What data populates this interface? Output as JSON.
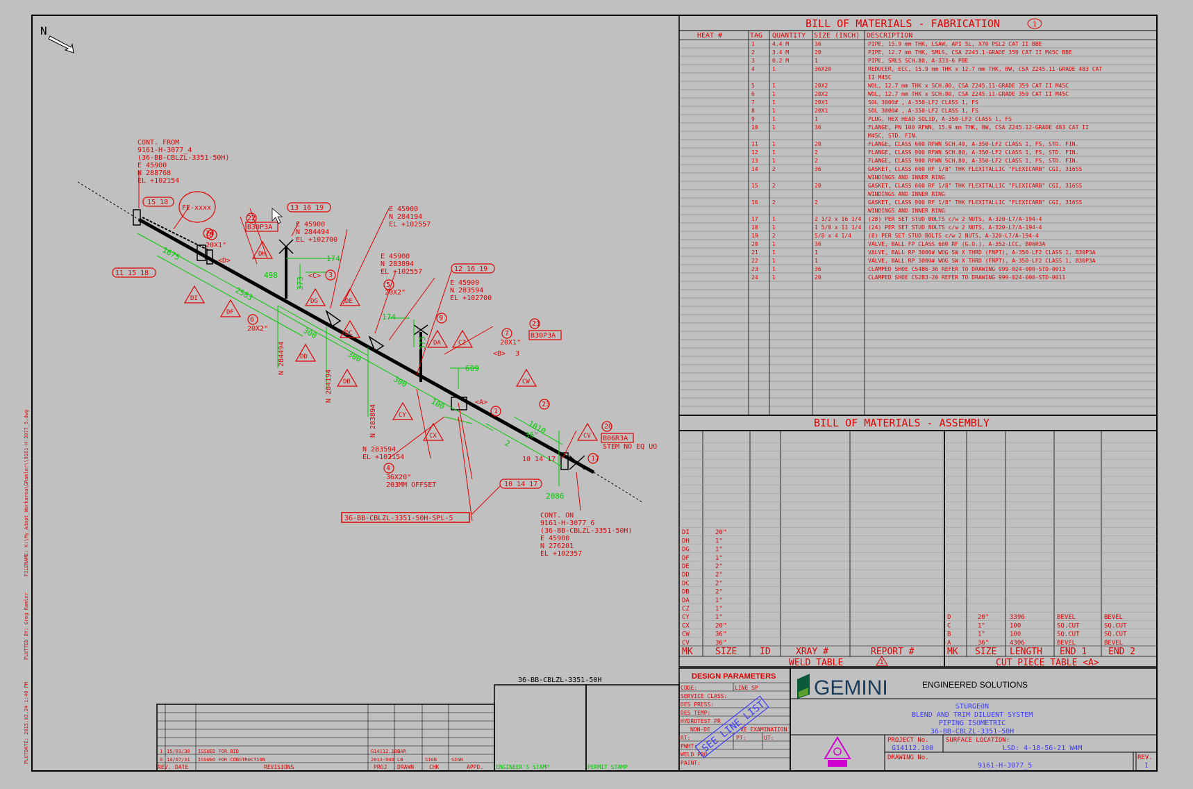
{
  "north": "N",
  "sheet_info": {
    "filename": "FILENAME: K:\\My_Adapt_Workarea\\GRamler\\\\9161-H-3077_5.dwg",
    "plotted_by": "PLOTTED BY: Greg Ramler",
    "plotdate": "PLOTDATE: 2015.03.24 1:40 PM"
  },
  "iso": {
    "cont_from": [
      "CONT. FROM",
      "9161-H-3077_4",
      "(36-BB-CBLZL-3351-50H)",
      "E 45900",
      "N 288768",
      "EL +102154"
    ],
    "cont_on": [
      "CONT. ON",
      "9161-H-3077_6",
      "(36-BB-CBLZL-3351-50H)",
      "E 45900",
      "N 276201",
      "EL +102357"
    ],
    "coord_a": [
      "E 45900",
      "N 284494",
      "EL +102700"
    ],
    "coord_b": [
      "E 45900",
      "N 284194",
      "EL +102557"
    ],
    "coord_c": [
      "E 45900",
      "N 283894",
      "EL +102557"
    ],
    "coord_d": [
      "E 45900",
      "N 283594",
      "EL +102700"
    ],
    "coord_e": [
      "N 283594",
      "EL +102154"
    ],
    "fe": "FE-xxxx",
    "bubbles": [
      "15 18",
      "13 16 19",
      "24",
      "22",
      "B30P3A",
      "8",
      "20X1\"",
      "<D>",
      "3",
      "<C>",
      "11 15 18",
      "498",
      "373",
      "174",
      "1675",
      "2583",
      "300",
      "6",
      "20X2\"",
      "5",
      "20X2\"",
      "12 16 19",
      "174",
      "9",
      "21",
      "B30P3A",
      "7",
      "20X1\"",
      "<B>",
      "3",
      "373",
      "609",
      "300",
      "300",
      "100",
      "<A>",
      "1",
      "23",
      "1010",
      "36\"",
      "20",
      "B06R3A",
      "STEM NO EQ UO",
      "4595",
      "2",
      "17",
      "10 14 17",
      "2086",
      "4",
      "36X20\"",
      "203MM OFFSET"
    ],
    "weld_tags": [
      "DI",
      "DF",
      "DH",
      "DG",
      "DE",
      "DD",
      "DC",
      "DB",
      "DA",
      "CZ",
      "CY",
      "CX",
      "CW",
      "CV"
    ],
    "n_labels": [
      "N 284494",
      "N 284194",
      "N 283894"
    ],
    "spool": "36-BB-CBLZL-3351-50H-SPL-5",
    "line_label": "36-BB-CBLZL-3351-50H"
  },
  "bom_fab": {
    "title": "BILL OF MATERIALS - FABRICATION",
    "title_badge": "1",
    "headers": [
      "HEAT #",
      "TAG",
      "QUANTITY",
      "SIZE (INCH)",
      "DESCRIPTION"
    ],
    "rows": [
      [
        "",
        "1",
        "4.4 M",
        "36",
        "PIPE, 15.9 mm THK, LSAW, API 5L, X70 PSL2 CAT II BBE"
      ],
      [
        "",
        "2",
        "3.4 M",
        "20",
        "PIPE, 12.7 mm THK, SMLS, CSA Z245.1-GRADE 359 CAT II M45C BBE"
      ],
      [
        "",
        "3",
        "0.2 M",
        "1",
        "PIPE, SMLS SCH.80, A-333-6 PBE"
      ],
      [
        "",
        "4",
        "1",
        "36X20",
        "REDUCER, ECC, 15.9 mm THK x 12.7 mm THK, BW, CSA Z245.11-GRADE 483 CAT"
      ],
      [
        "",
        "",
        "",
        "",
        "II M45C"
      ],
      [
        "",
        "5",
        "1",
        "20X2",
        "WOL, 12.7 mm THK x SCH.80, CSA Z245.11-GRADE 359 CAT II M45C"
      ],
      [
        "",
        "6",
        "1",
        "20X2",
        "WOL, 12.7 mm THK x SCH.80, CSA Z245.11-GRADE 359 CAT II M45C"
      ],
      [
        "",
        "7",
        "1",
        "20X1",
        "SOL 3000# , A-350-LF2 CLASS 1, FS"
      ],
      [
        "",
        "8",
        "1",
        "20X1",
        "SOL 3000# , A-350-LF2 CLASS 1, FS"
      ],
      [
        "",
        "9",
        "1",
        "1",
        "PLUG, HEX HEAD SOLID, A-350-LF2 CLASS 1, FS"
      ],
      [
        "",
        "10",
        "1",
        "36",
        "FLANGE, PN 100 RFWN, 15.9 mm THK, BW, CSA Z245.12-GRADE 483 CAT II"
      ],
      [
        "",
        "",
        "",
        "",
        "M45C, STD. FIN."
      ],
      [
        "",
        "11",
        "1",
        "20",
        "FLANGE, CLASS 600 RFWN SCH.40, A-350-LF2 CLASS 1, FS, STD. FIN."
      ],
      [
        "",
        "12",
        "1",
        "2",
        "FLANGE, CLASS 900 RFWN SCH.80, A-350-LF2 CLASS 1, FS, STD. FIN."
      ],
      [
        "",
        "13",
        "1",
        "2",
        "FLANGE, CLASS 900 RFWN SCH.80, A-350-LF2 CLASS 1, FS, STD. FIN."
      ],
      [
        "",
        "14",
        "2",
        "36",
        "GASKET, CLASS 600 RF 1/8\" THK FLEXITALLIC \"FLEXICARB\" CGI, 316SS"
      ],
      [
        "",
        "",
        "",
        "",
        "WINDINGS AND INNER RING"
      ],
      [
        "",
        "15",
        "2",
        "20",
        "GASKET, CLASS 600 RF 1/8\" THK FLEXITALLIC \"FLEXICARB\" CGI, 316SS"
      ],
      [
        "",
        "",
        "",
        "",
        "WINDINGS AND INNER RING"
      ],
      [
        "",
        "16",
        "2",
        "2",
        "GASKET, CLASS 900 RF 1/8\" THK FLEXITALLIC \"FLEXICARB\" CGI, 316SS"
      ],
      [
        "",
        "",
        "",
        "",
        "WINDINGS AND INNER RING"
      ],
      [
        "",
        "17",
        "1",
        "2 1/2 x 16 1/4",
        "(28) PER SET STUD BOLTS c/w 2 NUTS, A-320-L7/A-194-4"
      ],
      [
        "",
        "18",
        "1",
        "1 5/8 x 11 1/4",
        "(24) PER SET STUD BOLTS c/w 2 NUTS, A-320-L7/A-194-4"
      ],
      [
        "",
        "19",
        "2",
        "5/8 x 4 1/4",
        "(8) PER SET STUD BOLTS c/w 2 NUTS, A-320-L7/A-194-4"
      ],
      [
        "",
        "20",
        "1",
        "36",
        "VALVE, BALL FP CLASS 600 RF (G.O.), A-352-LCC, B06R3A"
      ],
      [
        "",
        "21",
        "1",
        "1",
        "VALVE, BALL RP 3000# WOG SW X THRD (FNPT), A-350-LF2 CLASS 1, B30P3A"
      ],
      [
        "",
        "22",
        "1",
        "1",
        "VALVE, BALL RP 3000# WOG SW X THRD (FNPT), A-350-LF2 CLASS 1, B30P3A"
      ],
      [
        "",
        "23",
        "1",
        "36",
        "CLAMPED SHOE CS4B6-36 REFER TO DRAWING 999-024-000-STD-0013"
      ],
      [
        "",
        "24",
        "1",
        "20",
        "CLAMPED SHOE CS2B3-20 REFER TO DRAWING 999-024-000-STD-0011"
      ]
    ]
  },
  "bom_asm": {
    "title": "BILL OF MATERIALS - ASSEMBLY"
  },
  "weld_table": {
    "title": "WELD TABLE",
    "badge": "1",
    "headers": [
      "MK",
      "SIZE",
      "ID",
      "XRAY #",
      "REPORT #"
    ],
    "rows": [
      [
        "DI",
        "20\""
      ],
      [
        "DH",
        "1\""
      ],
      [
        "DG",
        "1\""
      ],
      [
        "DF",
        "1\""
      ],
      [
        "DE",
        "2\""
      ],
      [
        "DD",
        "2\""
      ],
      [
        "DC",
        "2\""
      ],
      [
        "DB",
        "2\""
      ],
      [
        "DA",
        "1\""
      ],
      [
        "CZ",
        "1\""
      ],
      [
        "CY",
        "1\""
      ],
      [
        "CX",
        "20\""
      ],
      [
        "CW",
        "36\""
      ],
      [
        "CV",
        "36\""
      ]
    ]
  },
  "cut_table": {
    "title": "CUT PIECE TABLE  <A>",
    "headers": [
      "MK",
      "SIZE",
      "LENGTH",
      "END 1",
      "END 2"
    ],
    "rows": [
      [
        "D",
        "20\"",
        "3396",
        "BEVEL",
        "BEVEL"
      ],
      [
        "C",
        "1\"",
        "100",
        "SQ.CUT",
        "SQ.CUT"
      ],
      [
        "B",
        "1\"",
        "100",
        "SQ.CUT",
        "SQ.CUT"
      ],
      [
        "A",
        "36\"",
        "4306",
        "BEVEL",
        "BEVEL"
      ]
    ]
  },
  "revisions": {
    "rows": [
      [
        "1",
        "15/03/30",
        "ISSUED FOR BID",
        "G14112.100",
        "GAR",
        "",
        ""
      ],
      [
        "0",
        "14/07/31",
        "ISSUED FOR CONSTRUCTION",
        "2013-040",
        "LB",
        "SIGN",
        "SIGN"
      ]
    ],
    "headers": [
      "REV.",
      "DATE",
      "REVISIONS",
      "PROJ",
      "DRAWN",
      "CHK",
      "APPD."
    ],
    "engineer_stamp": "ENGINEER'S STAMP",
    "permit_stamp": "PERMIT STAMP",
    "line_label": "36-BB-CBLZL-3351-50H"
  },
  "design": {
    "title": "DESIGN PARAMETERS",
    "fields": [
      "CODE:",
      "SERVICE CLASS:",
      "DES PRESS:",
      "DES TEMP:",
      "HYDROTEST PR",
      "NON-DE",
      "RT:",
      "PWHT:",
      "WELD PRO",
      "PAINT:"
    ],
    "line_spec": "LINE SP",
    "exam": "VE EXAMINATION",
    "pt": "PT:",
    "ut": "UT:",
    "see_line_list": "SEE LINE LIST"
  },
  "title_block": {
    "company": "GEMINI",
    "tagline": "ENGINEERED SOLUTIONS",
    "lines": [
      "STURGEON",
      "BLEND AND TRIM DILUENT SYSTEM",
      "PIPING ISOMETRIC",
      "36-BB-CBLZL-3351-50H"
    ],
    "project_label": "PROJECT No.",
    "project_no": "G14112.100",
    "surface_label": "SURFACE LOCATION:",
    "lsd": "LSD: 4-18-56-21 W4M",
    "drawing_label": "DRAWING No.",
    "drawing_no": "9161-H-3077_5",
    "rev_label": "REV.",
    "rev": "1"
  },
  "colors": {
    "red": "#e00000",
    "green": "#00c800",
    "blue": "#3a3aff",
    "background": "#c0c0c0",
    "magenta": "#d000d0"
  }
}
